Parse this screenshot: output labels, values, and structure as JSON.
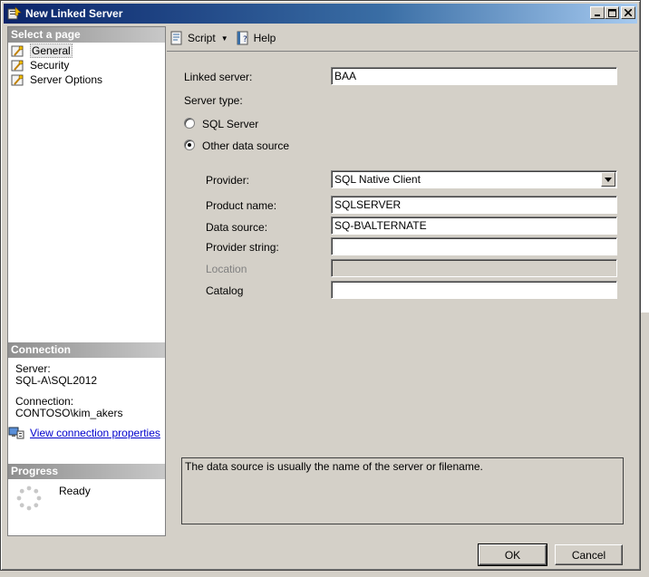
{
  "window": {
    "title": "New Linked Server"
  },
  "left_pane": {
    "select_page_header": "Select a page",
    "pages": [
      {
        "label": "General",
        "selected": true
      },
      {
        "label": "Security",
        "selected": false
      },
      {
        "label": "Server Options",
        "selected": false
      }
    ],
    "connection_header": "Connection",
    "server_label": "Server:",
    "server_value": "SQL-A\\SQL2012",
    "connection_label": "Connection:",
    "connection_value": "CONTOSO\\kim_akers",
    "view_connection_link": "View connection properties",
    "progress_header": "Progress",
    "progress_status": "Ready"
  },
  "toolbar": {
    "script_label": "Script",
    "help_label": "Help"
  },
  "form": {
    "linked_server_label": "Linked server:",
    "linked_server_value": "BAA",
    "server_type_label": "Server type:",
    "sql_server_label": "SQL Server",
    "other_data_source_label": "Other data source",
    "provider_label": "Provider:",
    "provider_value": "SQL Native Client",
    "product_name_label": "Product name:",
    "product_name_value": "SQLSERVER",
    "data_source_label": "Data source:",
    "data_source_value": "SQ-B\\ALTERNATE",
    "provider_string_label": "Provider string:",
    "provider_string_value": "",
    "location_label": "Location",
    "location_value": "",
    "catalog_label": "Catalog",
    "catalog_value": "",
    "description": "The data source is usually the name of the server or filename."
  },
  "buttons": {
    "ok_label": "OK",
    "cancel_label": "Cancel"
  }
}
